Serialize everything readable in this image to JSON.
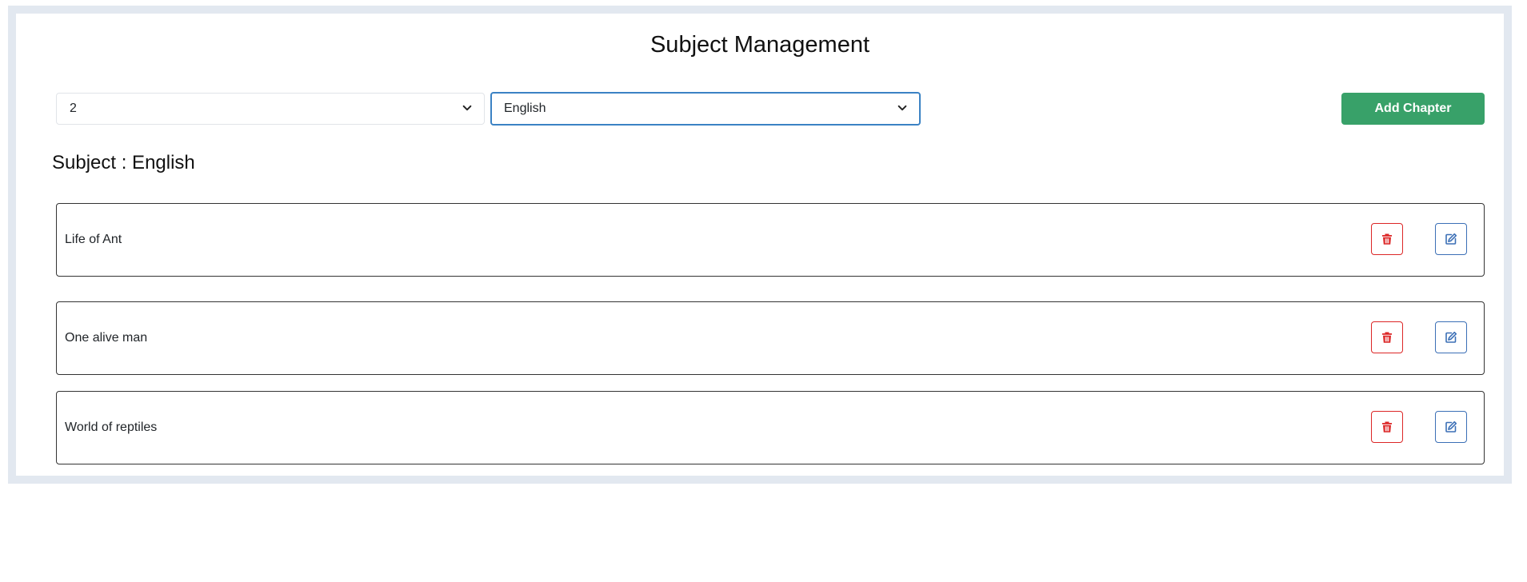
{
  "page": {
    "title": "Subject Management"
  },
  "filters": {
    "class_select_value": "2",
    "subject_select_value": "English"
  },
  "toolbar": {
    "add_chapter_label": "Add Chapter"
  },
  "subject": {
    "heading": "Subject : English"
  },
  "chapters": [
    {
      "name": "Life of Ant"
    },
    {
      "name": "One alive man"
    },
    {
      "name": "World of reptiles"
    }
  ],
  "colors": {
    "accent_green": "#38a169",
    "delete_red": "#dc2626",
    "edit_blue": "#3b6fb6",
    "focus_blue": "#3b82c4",
    "frame_border": "#e2e8f0"
  },
  "icons": {
    "select_chevron": "chevron-down-icon",
    "delete": "trash-icon",
    "edit": "edit-icon"
  }
}
